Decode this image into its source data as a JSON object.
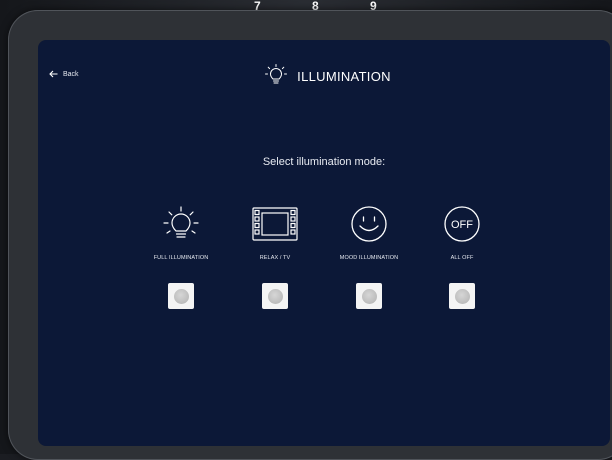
{
  "background": {
    "numbers": [
      "7",
      "8",
      "9"
    ]
  },
  "header": {
    "back_label": "Back",
    "title": "ILLUMINATION",
    "title_icon": "lightbulb-icon"
  },
  "main": {
    "prompt": "Select illumination mode:",
    "modes": [
      {
        "label": "FULL ILLUMINATION",
        "icon": "bright-bulb-icon"
      },
      {
        "label": "RELAX / TV",
        "icon": "film-strip-icon"
      },
      {
        "label": "MOOD ILLUMINATION",
        "icon": "smiley-face-icon"
      },
      {
        "label": "ALL OFF",
        "icon": "off-circle-icon",
        "icon_text": "OFF"
      }
    ]
  },
  "colors": {
    "screen_bg": "#0c1837",
    "text": "#ffffff",
    "button": "#f4f4f4"
  }
}
